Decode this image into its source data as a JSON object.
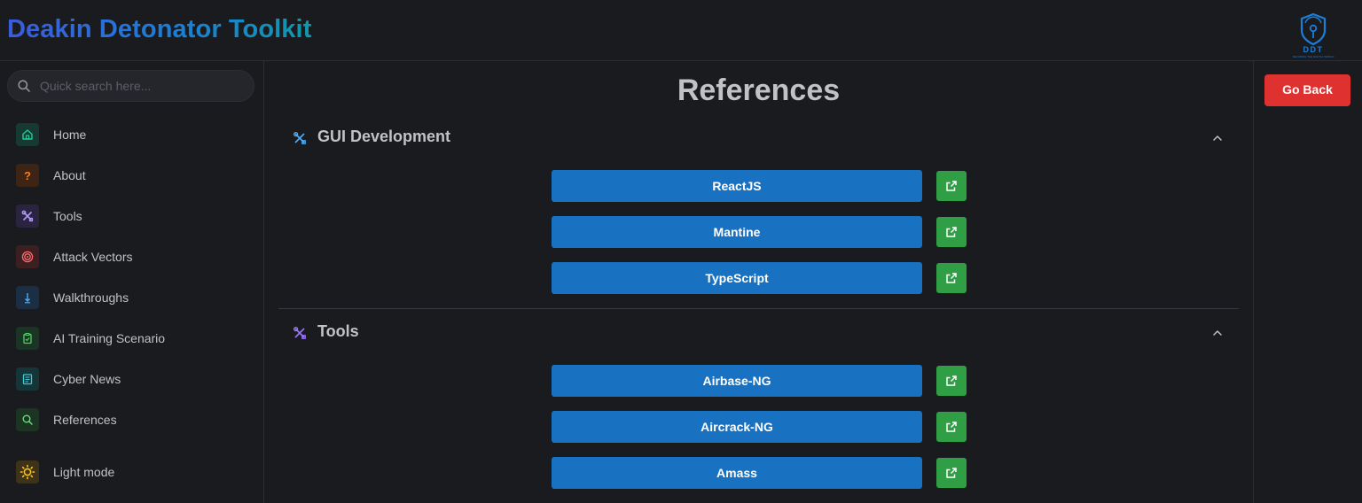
{
  "header": {
    "title": "Deakin Detonator Toolkit",
    "logo_text": "DDT",
    "logo_tagline": "SECURING THE DIGITAL WORLD"
  },
  "search": {
    "placeholder": "Quick search here..."
  },
  "sidebar": {
    "items": [
      {
        "label": "Home",
        "icon": "home-icon",
        "color": "#20c997",
        "bg": "#163a31"
      },
      {
        "label": "About",
        "icon": "question-icon",
        "color": "#fd7e14",
        "bg": "#3d2414"
      },
      {
        "label": "Tools",
        "icon": "tools-icon",
        "color": "#b197fc",
        "bg": "#2b2440"
      },
      {
        "label": "Attack Vectors",
        "icon": "target-icon",
        "color": "#ff6b6b",
        "bg": "#3d1f22"
      },
      {
        "label": "Walkthroughs",
        "icon": "arrow-down-icon",
        "color": "#4dabf7",
        "bg": "#1c2e44"
      },
      {
        "label": "AI Training Scenario",
        "icon": "clipboard-icon",
        "color": "#51cf66",
        "bg": "#1b3524"
      },
      {
        "label": "Cyber News",
        "icon": "news-icon",
        "color": "#3bc9db",
        "bg": "#163539"
      },
      {
        "label": "References",
        "icon": "search-icon",
        "color": "#69db7c",
        "bg": "#1c3523"
      },
      {
        "label": "Light mode",
        "icon": "sun-icon",
        "color": "#fcc419",
        "bg": "#3e3319"
      }
    ]
  },
  "main": {
    "title": "References",
    "sections": [
      {
        "title": "GUI Development",
        "icon": "tools-icon",
        "icon_color": "#4dabf7",
        "links": [
          {
            "label": "ReactJS"
          },
          {
            "label": "Mantine"
          },
          {
            "label": "TypeScript"
          }
        ]
      },
      {
        "title": "Tools",
        "icon": "tools-icon",
        "icon_color": "#9775fa",
        "links": [
          {
            "label": "Airbase-NG"
          },
          {
            "label": "Aircrack-NG"
          },
          {
            "label": "Amass"
          }
        ]
      }
    ]
  },
  "actions": {
    "go_back": "Go Back"
  },
  "colors": {
    "background": "#1a1b1e",
    "link_button": "#1971c2",
    "external_button": "#2f9e44",
    "go_back_button": "#e03131"
  }
}
